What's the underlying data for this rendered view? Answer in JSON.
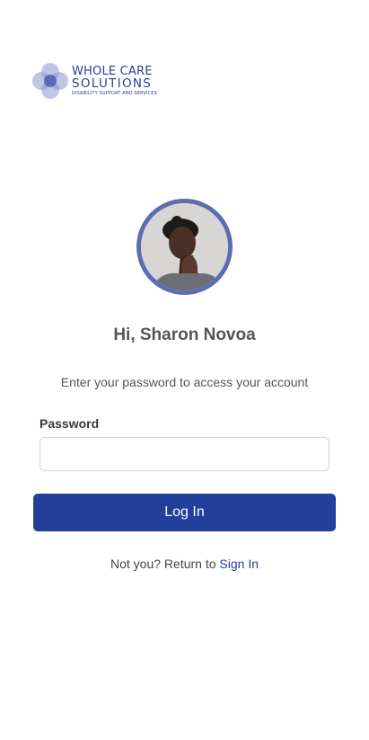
{
  "logo": {
    "line1": "WHOLE CARE",
    "line2": "SOLUTIONS",
    "line3": "DISABILITY SUPPORT AND SERVICES"
  },
  "greeting": "Hi, Sharon Novoa",
  "instruction": "Enter your password to access your account",
  "password": {
    "label": "Password",
    "value": "",
    "placeholder": ""
  },
  "login_button": "Log In",
  "return": {
    "prefix": "Not you? Return to",
    "link": "Sign In"
  },
  "colors": {
    "primary": "#233f9c",
    "avatar_ring": "#5a6db0"
  }
}
